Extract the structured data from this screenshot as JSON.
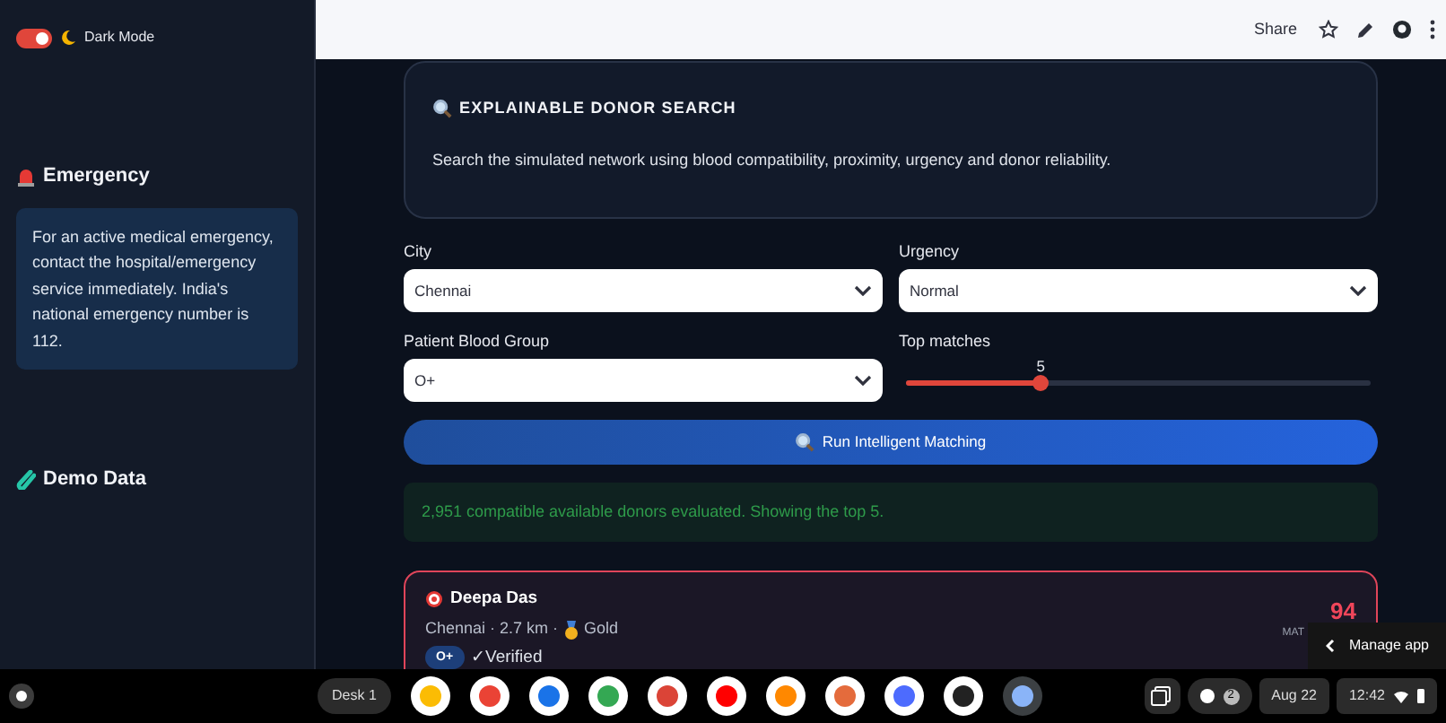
{
  "sidebar": {
    "dark_mode": {
      "label": "Dark Mode",
      "on": true
    },
    "emergency": {
      "title": "Emergency",
      "text": "For an active medical emergency, contact the hospital/emergency service immediately. India's national emergency number is 112."
    },
    "demo_title": "Demo Data"
  },
  "header": {
    "share": "Share"
  },
  "intro": {
    "title": "EXPLAINABLE DONOR SEARCH",
    "text": "Search the simulated network using blood compatibility, proximity, urgency and donor reliability."
  },
  "fields": [
    {
      "kind": "select",
      "label": "City",
      "value": "Chennai"
    },
    {
      "kind": "select",
      "label": "Urgency",
      "value": "Normal"
    },
    {
      "kind": "select",
      "label": "Patient Blood Group",
      "value": "O+"
    },
    {
      "kind": "slider",
      "label": "Top matches",
      "reading": "5",
      "level": 0.29
    }
  ],
  "run_button": "Run Intelligent Matching",
  "result_message": "2,951 compatible available donors evaluated. Showing the top 5.",
  "matches": [
    {
      "name": "Deepa Das",
      "details": "Chennai · 2.7 km · ",
      "tier": "Gold",
      "blood_group": "O+",
      "verified": "✓Verified",
      "score": "94",
      "score_label": "MAT"
    }
  ],
  "tooltip": {
    "label": "Manage app"
  },
  "taskbar": {
    "desk": "Desk 1",
    "apps": [
      {
        "kind": "meet"
      },
      {
        "kind": "mail"
      },
      {
        "kind": "files"
      },
      {
        "kind": "play"
      },
      {
        "kind": "chrome"
      },
      {
        "kind": "youtube"
      },
      {
        "kind": "vlc"
      },
      {
        "kind": "sun"
      },
      {
        "kind": "whale"
      },
      {
        "kind": "knot"
      },
      {
        "kind": "code"
      }
    ],
    "notifications": "2",
    "date": "Aug 22",
    "time": "12:42"
  }
}
